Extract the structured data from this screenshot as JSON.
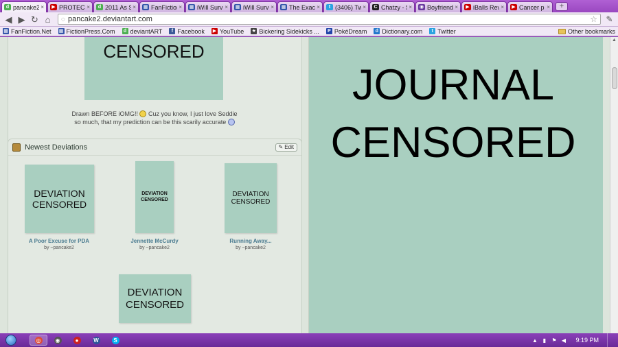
{
  "browser": {
    "tabs": [
      {
        "title": "pancake2",
        "fav_color": "#4caf50",
        "fav_glyph": "d",
        "active": true
      },
      {
        "title": "PROTECT",
        "fav_color": "#cc0000",
        "fav_glyph": "▶",
        "active": false
      },
      {
        "title": "2011 As S",
        "fav_color": "#4caf50",
        "fav_glyph": "d",
        "active": false
      },
      {
        "title": "FanFiction",
        "fav_color": "#3355aa",
        "fav_glyph": "▦",
        "active": false
      },
      {
        "title": "iWill Survi",
        "fav_color": "#3355aa",
        "fav_glyph": "▦",
        "active": false
      },
      {
        "title": "iWill Survi",
        "fav_color": "#3355aa",
        "fav_glyph": "▦",
        "active": false
      },
      {
        "title": "The Exact",
        "fav_color": "#3355aa",
        "fav_glyph": "▦",
        "active": false
      },
      {
        "title": "(3406) Tw",
        "fav_color": "#2ba3e0",
        "fav_glyph": "t",
        "active": false
      },
      {
        "title": "Chatzy - S",
        "fav_color": "#222222",
        "fav_glyph": "C",
        "active": false
      },
      {
        "title": "Boyfriend",
        "fav_color": "#6a3aa0",
        "fav_glyph": "◉",
        "active": false
      },
      {
        "title": "iBalls Revi",
        "fav_color": "#cc0000",
        "fav_glyph": "▶",
        "active": false
      },
      {
        "title": "Cancer p",
        "fav_color": "#cc0000",
        "fav_glyph": "▶",
        "active": false
      }
    ],
    "tab_close_glyph": "×",
    "new_tab_glyph": "+",
    "nav": {
      "back": "◀",
      "forward": "▶",
      "reload": "↻",
      "home": "⌂"
    },
    "url": "pancake2.deviantart.com",
    "star_glyph": "☆",
    "wrench_glyph": "✎",
    "bookmarks": [
      {
        "label": "FanFiction.Net",
        "color": "#3355aa",
        "glyph": "▦"
      },
      {
        "label": "FictionPress.Com",
        "color": "#3355aa",
        "glyph": "▦"
      },
      {
        "label": "deviantART",
        "color": "#4caf50",
        "glyph": "d"
      },
      {
        "label": "Facebook",
        "color": "#3b5998",
        "glyph": "f"
      },
      {
        "label": "YouTube",
        "color": "#cc0000",
        "glyph": "▶"
      },
      {
        "label": "Bickering Sidekicks ...",
        "color": "#444444",
        "glyph": "★"
      },
      {
        "label": "PokéDream",
        "color": "#2244aa",
        "glyph": "P"
      },
      {
        "label": "Dictionary.com",
        "color": "#2277cc",
        "glyph": "d"
      },
      {
        "label": "Twitter",
        "color": "#2ba3e0",
        "glyph": "t"
      }
    ],
    "other_bookmarks": "Other bookmarks"
  },
  "page": {
    "top_censored": "CENSORED",
    "drawn_line1": "Drawn BEFORE iOMG!!",
    "drawn_line1b": "Cuz you know, I just love Seddie",
    "drawn_line2": "so much, that my prediction can be this scarily accurate",
    "newest_title": "Newest Deviations",
    "edit_label": "Edit",
    "deviation_text_a": "DEVIATION",
    "deviation_text_b": "CENSORED",
    "deviations": [
      {
        "title": "A Poor Excuse for PDA",
        "by": "by ~pancake2"
      },
      {
        "title": "Jennette McCurdy",
        "by": "by ~pancake2"
      },
      {
        "title": "Running Away...",
        "by": "by ~pancake2"
      }
    ],
    "journal_line1": "JOURNAL",
    "journal_line2": "CENSORED"
  },
  "taskbar": {
    "apps": [
      {
        "name": "chrome",
        "color": "#dd4b39",
        "glyph": "◎",
        "active": true
      },
      {
        "name": "media",
        "color": "#555555",
        "glyph": "◉",
        "active": false
      },
      {
        "name": "app3",
        "color": "#cc2222",
        "glyph": "●",
        "active": false
      },
      {
        "name": "word",
        "color": "#2b579a",
        "glyph": "W",
        "active": false
      },
      {
        "name": "skype",
        "color": "#00aff0",
        "glyph": "S",
        "active": false
      }
    ],
    "clock": "9:19 PM"
  }
}
